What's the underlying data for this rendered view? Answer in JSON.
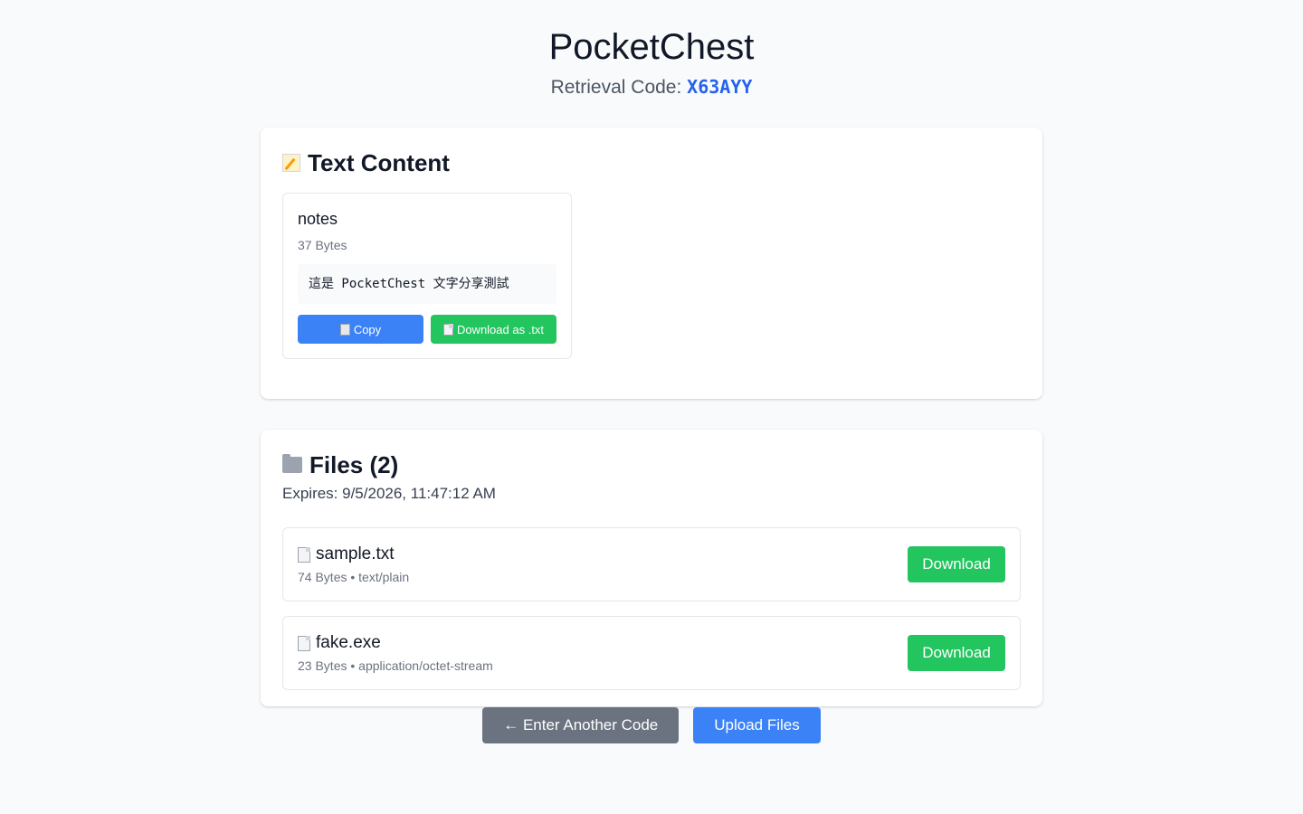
{
  "header": {
    "app_title": "PocketChest",
    "retrieval_label": "Retrieval Code:",
    "retrieval_code": "X63AYY"
  },
  "text_section": {
    "heading": "Text Content",
    "heading_icon": "memo-icon",
    "item": {
      "name": "notes",
      "size": "37 Bytes",
      "content": "這是 PocketChest 文字分享測試",
      "copy_label": "Copy",
      "download_label": "Download as .txt"
    }
  },
  "files_section": {
    "heading": "Files (2)",
    "heading_icon": "folder-icon",
    "expires": "Expires: 9/5/2026, 11:47:12 AM",
    "files": [
      {
        "name": "sample.txt",
        "meta": "74 Bytes • text/plain",
        "download_label": "Download"
      },
      {
        "name": "fake.exe",
        "meta": "23 Bytes • application/octet-stream",
        "download_label": "Download"
      }
    ]
  },
  "footer": {
    "enter_another_label": "← Enter Another Code",
    "upload_label": "Upload Files"
  },
  "colors": {
    "accent_blue": "#3b82f6",
    "code_blue": "#2563eb",
    "success_green": "#22c55e",
    "neutral_gray": "#6b7280",
    "background": "#f8fafc"
  }
}
